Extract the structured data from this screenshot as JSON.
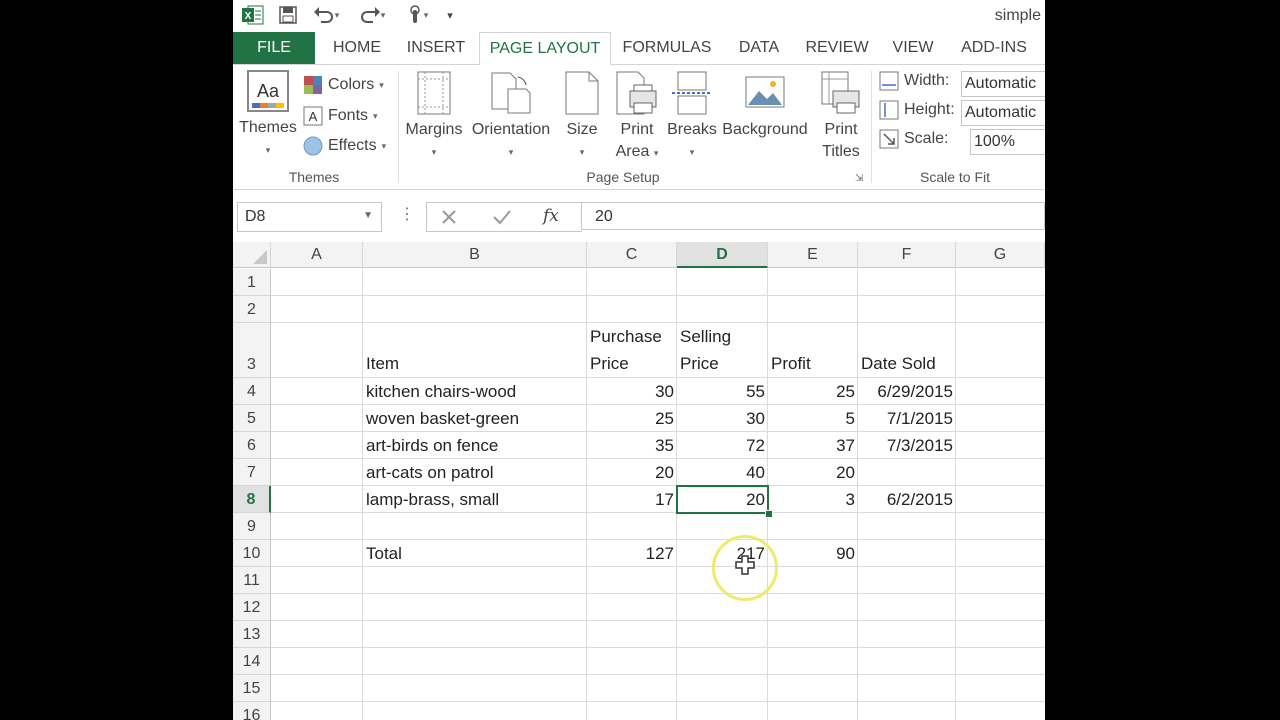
{
  "window": {
    "title": "simple",
    "app_icon": "excel-icon"
  },
  "ribbon_tabs": [
    "FILE",
    "HOME",
    "INSERT",
    "PAGE LAYOUT",
    "FORMULAS",
    "DATA",
    "REVIEW",
    "VIEW",
    "ADD-INS"
  ],
  "active_tab": "PAGE LAYOUT",
  "themes_group": {
    "label": "Themes",
    "themes_button": "Themes",
    "colors": "Colors",
    "fonts": "Fonts",
    "effects": "Effects"
  },
  "page_setup_group": {
    "label": "Page Setup",
    "margins": "Margins",
    "orientation": "Orientation",
    "size": "Size",
    "print_area_1": "Print",
    "print_area_2": "Area",
    "breaks": "Breaks",
    "background": "Background",
    "print_titles_1": "Print",
    "print_titles_2": "Titles"
  },
  "scale_group": {
    "label": "Scale to Fit",
    "width_label": "Width:",
    "width_value": "Automatic",
    "height_label": "Height:",
    "height_value": "Automatic",
    "scale_label": "Scale:",
    "scale_value": "100%"
  },
  "formula_bar": {
    "name_box": "D8",
    "fx": "fx",
    "value": "20"
  },
  "columns": [
    "A",
    "B",
    "C",
    "D",
    "E",
    "F",
    "G"
  ],
  "selected_column": "D",
  "selected_row": "8",
  "rows": [
    "1",
    "2",
    "3",
    "4",
    "5",
    "6",
    "7",
    "8",
    "9",
    "10",
    "11",
    "12",
    "13",
    "14",
    "15",
    "16"
  ],
  "headers": {
    "item": "Item",
    "purchase_1": "Purchase",
    "purchase_2": "Price",
    "selling_1": "Selling",
    "selling_2": "Price",
    "profit": "Profit",
    "date_sold": "Date Sold"
  },
  "data_rows": [
    {
      "item": "kitchen chairs-wood",
      "purchase": "30",
      "selling": "55",
      "profit": "25",
      "date": "6/29/2015"
    },
    {
      "item": "woven basket-green",
      "purchase": "25",
      "selling": "30",
      "profit": "5",
      "date": "7/1/2015"
    },
    {
      "item": "art-birds on fence",
      "purchase": "35",
      "selling": "72",
      "profit": "37",
      "date": "7/3/2015"
    },
    {
      "item": "art-cats on patrol",
      "purchase": "20",
      "selling": "40",
      "profit": "20",
      "date": ""
    },
    {
      "item": "lamp-brass, small",
      "purchase": "17",
      "selling": "20",
      "profit": "3",
      "date": "6/2/2015"
    }
  ],
  "total_row": {
    "label": "Total",
    "purchase": "127",
    "selling": "217",
    "profit": "90"
  },
  "colors": {
    "excel_green": "#217346",
    "cursor_highlight": "#f0ea6a"
  }
}
